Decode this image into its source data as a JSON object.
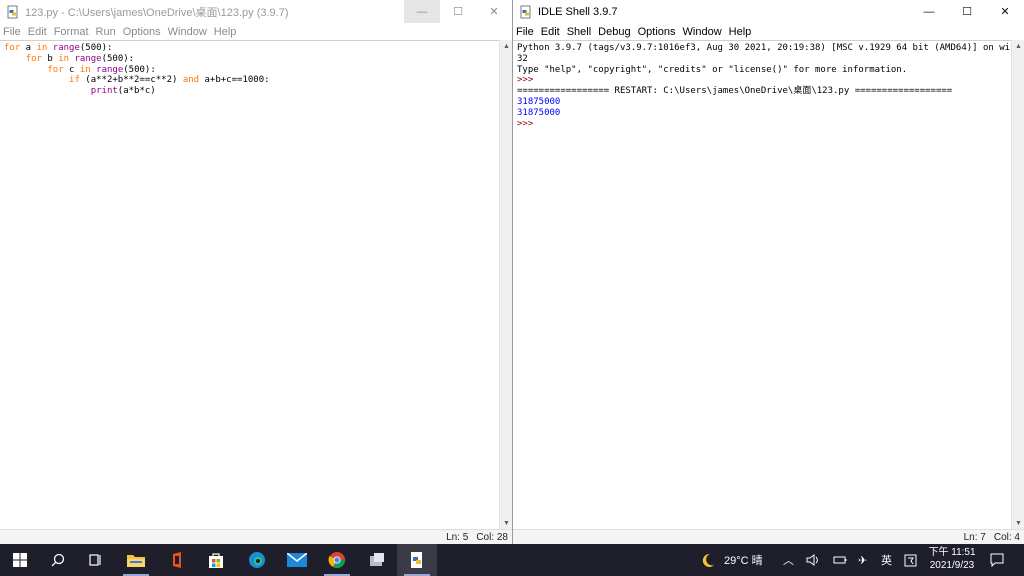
{
  "editor": {
    "title": "123.py - C:\\Users\\james\\OneDrive\\桌面\\123.py (3.9.7)",
    "menu": [
      "File",
      "Edit",
      "Format",
      "Run",
      "Options",
      "Window",
      "Help"
    ],
    "code": [
      [
        [
          "kw",
          "for"
        ],
        [
          "tx",
          " a "
        ],
        [
          "kw",
          "in"
        ],
        [
          "tx",
          " "
        ],
        [
          "bi",
          "range"
        ],
        [
          "tx",
          "(500):"
        ]
      ],
      [
        [
          "tx",
          "    "
        ],
        [
          "kw",
          "for"
        ],
        [
          "tx",
          " b "
        ],
        [
          "kw",
          "in"
        ],
        [
          "tx",
          " "
        ],
        [
          "bi",
          "range"
        ],
        [
          "tx",
          "(500):"
        ]
      ],
      [
        [
          "tx",
          "        "
        ],
        [
          "kw",
          "for"
        ],
        [
          "tx",
          " c "
        ],
        [
          "kw",
          "in"
        ],
        [
          "tx",
          " "
        ],
        [
          "bi",
          "range"
        ],
        [
          "tx",
          "(500):"
        ]
      ],
      [
        [
          "tx",
          "            "
        ],
        [
          "kw",
          "if"
        ],
        [
          "tx",
          " (a**2+b**2==c**2) "
        ],
        [
          "kw",
          "and"
        ],
        [
          "tx",
          " a+b+c==1000:"
        ]
      ],
      [
        [
          "tx",
          "                "
        ],
        [
          "bi",
          "print"
        ],
        [
          "tx",
          "(a*b*c)"
        ]
      ]
    ],
    "status": {
      "ln": "Ln: 5",
      "col": "Col: 28"
    }
  },
  "shell": {
    "title": "IDLE Shell 3.9.7",
    "menu": [
      "File",
      "Edit",
      "Shell",
      "Debug",
      "Options",
      "Window",
      "Help"
    ],
    "lines": [
      [
        [
          "tx",
          "Python 3.9.7 (tags/v3.9.7:1016ef3, Aug 30 2021, 20:19:38) [MSC v.1929 64 bit (AMD64)] on win"
        ]
      ],
      [
        [
          "tx",
          "32"
        ]
      ],
      [
        [
          "tx",
          "Type \"help\", \"copyright\", \"credits\" or \"license()\" for more information."
        ]
      ],
      [
        [
          "prompt",
          ">>> "
        ]
      ],
      [
        [
          "tx",
          "================= RESTART: C:\\Users\\james\\OneDrive\\桌面\\123.py =================="
        ]
      ],
      [
        [
          "out",
          "31875000"
        ]
      ],
      [
        [
          "out",
          "31875000"
        ]
      ],
      [
        [
          "prompt",
          ">>> "
        ]
      ]
    ],
    "status": {
      "ln": "Ln: 7",
      "col": "Col: 4"
    }
  },
  "window_controls": {
    "minimize": "—",
    "maximize": "☐",
    "close": "✕"
  },
  "taskbar": {
    "weather": "29°C 晴",
    "ime": "英",
    "time": "下午 11:51",
    "date": "2021/9/23",
    "colors": {
      "bg": "#1e1f2b",
      "accent": "#9aa7d8"
    }
  }
}
